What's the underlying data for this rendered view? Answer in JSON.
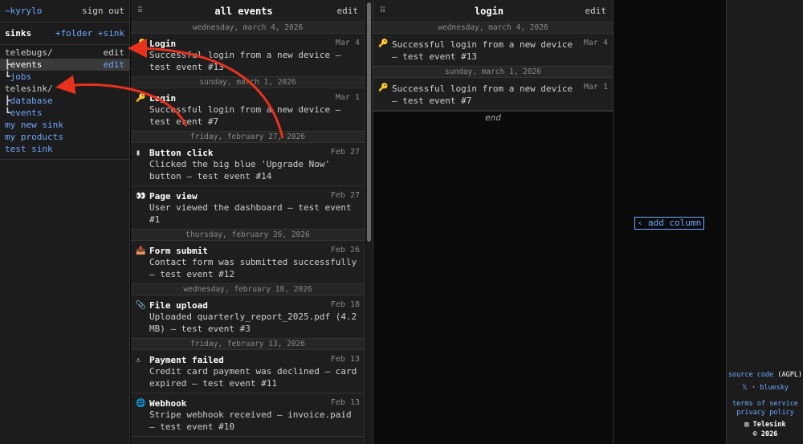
{
  "sidebar": {
    "user": "~kyrylo",
    "sign_out": "sign out",
    "title": "sinks",
    "add_folder": "+folder",
    "add_sink": "+sink",
    "tree": [
      {
        "prefix": "",
        "label": "telebugs/",
        "type": "folder",
        "edit": "edit"
      },
      {
        "prefix": "┣",
        "label": "events",
        "type": "sink",
        "selected": true,
        "edit": "edit"
      },
      {
        "prefix": "┗",
        "label": "jobs",
        "type": "sink"
      },
      {
        "prefix": "",
        "label": "telesink/",
        "type": "folder"
      },
      {
        "prefix": "┣",
        "label": "database",
        "type": "sink"
      },
      {
        "prefix": "┗",
        "label": "events",
        "type": "sink"
      },
      {
        "prefix": "",
        "label": "my new sink",
        "type": "sink"
      },
      {
        "prefix": "",
        "label": "my products",
        "type": "sink"
      },
      {
        "prefix": "",
        "label": "test sink",
        "type": "sink"
      }
    ]
  },
  "columns": [
    {
      "title": "all events",
      "edit": "edit",
      "groups": [
        {
          "day": "wednesday, march 4, 2026",
          "events": [
            {
              "icon": "🔑",
              "icon_name": "key-icon",
              "title": "Login",
              "date": "Mar 4",
              "desc": "Successful login from a new device — test event #13"
            }
          ]
        },
        {
          "day": "sunday, march 1, 2026",
          "events": [
            {
              "icon": "🔑",
              "icon_name": "key-icon",
              "title": "Login",
              "date": "Mar 1",
              "desc": "Successful login from a new device — test event #7"
            }
          ]
        },
        {
          "day": "friday, february 27, 2026",
          "events": [
            {
              "icon": "▮",
              "icon_name": "mouse-icon",
              "title": "Button click",
              "date": "Feb 27",
              "desc": "Clicked the big blue 'Upgrade Now' button — test event #14"
            },
            {
              "icon": "👀",
              "icon_name": "eyes-icon",
              "title": "Page view",
              "date": "Feb 27",
              "desc": "User viewed the dashboard — test event #1"
            }
          ]
        },
        {
          "day": "thursday, february 26, 2026",
          "events": [
            {
              "icon": "📥",
              "icon_name": "inbox-icon",
              "title": "Form submit",
              "date": "Feb 26",
              "desc": "Contact form was submitted successfully — test event #12"
            }
          ]
        },
        {
          "day": "wednesday, february 18, 2026",
          "events": [
            {
              "icon": "📎",
              "icon_name": "paperclip-icon",
              "title": "File upload",
              "date": "Feb 18",
              "desc": "Uploaded quarterly_report_2025.pdf (4.2 MB) — test event #3"
            }
          ]
        },
        {
          "day": "friday, february 13, 2026",
          "events": [
            {
              "icon": "⚠",
              "icon_name": "warning-icon",
              "title": "Payment failed",
              "date": "Feb 13",
              "desc": "Credit card payment was declined — card expired — test event #11"
            },
            {
              "icon": "🌐",
              "icon_name": "globe-icon",
              "title": "Webhook",
              "date": "Feb 13",
              "desc": "Stripe webhook received — invoice.paid — test event #10"
            }
          ]
        }
      ]
    },
    {
      "title": "login",
      "edit": "edit",
      "end": "end",
      "groups": [
        {
          "day": "wednesday, march 4, 2026",
          "events": [
            {
              "icon": "🔑",
              "icon_name": "key-icon",
              "date": "Mar 4",
              "desc": "Successful login from a new device — test event #13"
            }
          ]
        },
        {
          "day": "sunday, march 1, 2026",
          "events": [
            {
              "icon": "🔑",
              "icon_name": "key-icon",
              "date": "Mar 1",
              "desc": "Successful login from a new device — test event #7"
            }
          ]
        }
      ]
    }
  ],
  "add_column": "‹ add column",
  "footer": {
    "source_code": "source code",
    "license": "(AGPL)",
    "x": "𝕏",
    "sep": "·",
    "bluesky": "bluesky",
    "terms": "terms of service",
    "privacy": "privacy policy",
    "brand": "Telesink",
    "copyright": "© 2026"
  },
  "colors": {
    "accent": "#6fa8ff",
    "arrow": "#e8321e"
  }
}
